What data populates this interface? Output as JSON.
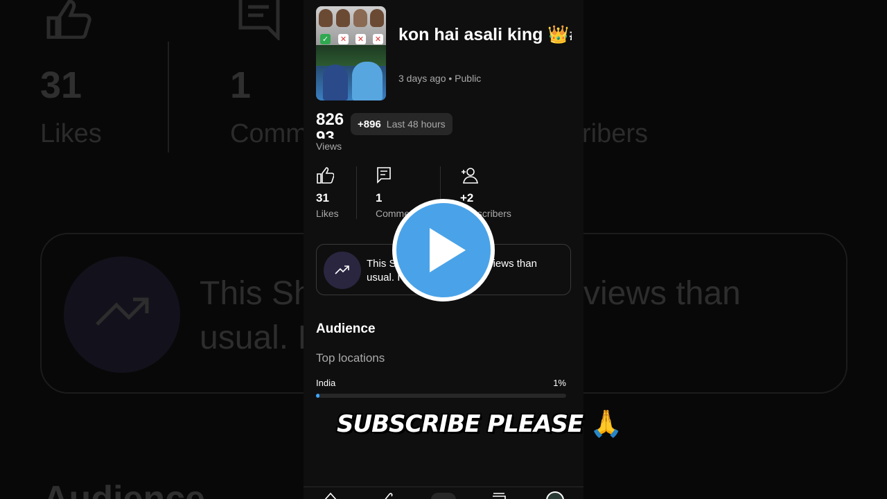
{
  "video": {
    "title": "kon hai asali king 👑#ipl #shortsfee…",
    "meta": "3 days ago • Public"
  },
  "views": {
    "number": "826 93",
    "label": "Views",
    "chip_delta": "+896",
    "chip_label": "Last 48 hours"
  },
  "stats": [
    {
      "icon": "thumbs-up-icon",
      "value": "31",
      "label": "Likes"
    },
    {
      "icon": "comment-icon",
      "value": "1",
      "label": "Comments"
    },
    {
      "icon": "add-person-icon",
      "value": "+2",
      "label": "Subscribers"
    }
  ],
  "insight": {
    "icon": "trending-up-icon",
    "text": "This Short is getting more views than usual. I"
  },
  "audience": {
    "heading": "Audience",
    "subheading": "Top locations",
    "locations": [
      {
        "name": "India",
        "percent_label": "1%",
        "percent": 1
      }
    ]
  },
  "overlay": {
    "subscribe_text": "SUBSCRIBE PLEASE",
    "emoji": "🙏",
    "play_color": "#4aa3e8"
  },
  "background": {
    "likes_value": "31",
    "likes_label": "Likes",
    "comments_value": "1",
    "comments_label": "Comm",
    "subscribers_label": "ribers",
    "card_line1": "This Sh",
    "card_line1b": "views than",
    "card_line2": "usual. I",
    "audience_label": "Audience"
  },
  "colors": {
    "accent": "#3ea6ff",
    "panel_bg": "#0f0f0f",
    "secondary_text": "#aaaaaa"
  }
}
